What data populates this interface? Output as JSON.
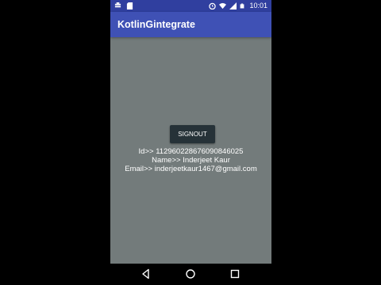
{
  "status_bar": {
    "time": "10:01",
    "icons": [
      "notification-icon",
      "sd-card-icon",
      "alarm-icon",
      "wifi-icon",
      "signal-icon",
      "battery-icon"
    ]
  },
  "app_bar": {
    "title": "KotlinGintegrate",
    "color": "#3f51b5"
  },
  "main": {
    "signout_label": "SIGNOUT",
    "id_line": "Id>> 112960228676090846025",
    "name_line": "Name>> Inderjeet Kaur",
    "email_line": "Email>> inderjeetkaur1467@gmail.com"
  },
  "nav_bar": {
    "buttons": [
      "back-icon",
      "home-icon",
      "recents-icon"
    ]
  },
  "colors": {
    "status_bar": "#303f9f",
    "background": "#737b7b",
    "button": "#263238"
  }
}
